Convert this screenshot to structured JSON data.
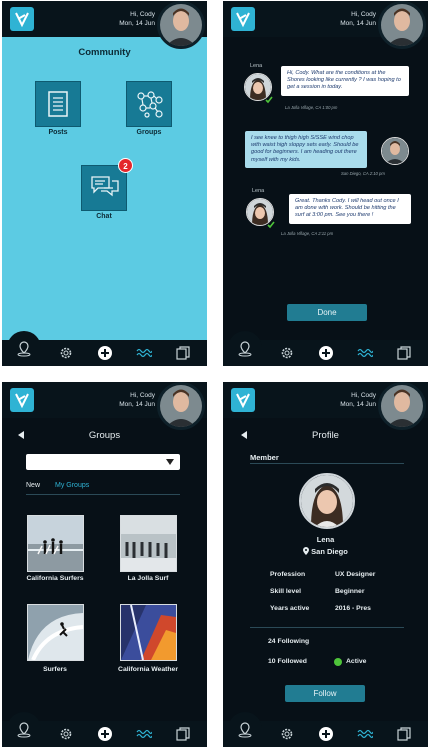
{
  "colors": {
    "accent": "#2fb3d4",
    "primary_button": "#217c92",
    "screen_bg": "#071017",
    "community_bg": "#5ccbe3",
    "badge": "#e4262b",
    "active_dot": "#4ec43a"
  },
  "header": {
    "greeting": "Hi, Cody",
    "date": "Mon, 14 Jun"
  },
  "nav_icons": [
    "map-pin-icon",
    "gear-icon",
    "plus-icon",
    "waves-icon",
    "copy-icon"
  ],
  "community": {
    "title": "Community",
    "tiles": [
      {
        "label": "Posts",
        "icon": "document-icon"
      },
      {
        "label": "Groups",
        "icon": "network-icon"
      },
      {
        "label": "Chat",
        "icon": "chat-icon",
        "badge": "2"
      }
    ]
  },
  "chat": {
    "messages": [
      {
        "sender": "Lena",
        "text": "Hi, Cody. What are the conditions at the Shores looking like currently ? I was hoping to get a session in today.",
        "meta": "La Jolla Village, CA 1:00 pm"
      },
      {
        "sender": "",
        "text": "I see knee to thigh high S/SSE wind chop with waist high sloppy sets early. Should be good for beginners. I am heading out there myself with my kids.",
        "meta": "San Diego, CA 2:10 pm"
      },
      {
        "sender": "Lena",
        "text": "Great. Thanks Cody. I will head out once I am done with work. Should be hitting the surf at 3:00 pm. See you there !",
        "meta": "La Jolla Village, CA 2:11 pm"
      }
    ],
    "done_label": "Done"
  },
  "groups": {
    "title": "Groups",
    "dropdown_value": "",
    "tabs": [
      "New",
      "My Groups"
    ],
    "items": [
      {
        "label": "California Surfers"
      },
      {
        "label": "La Jolla Surf"
      },
      {
        "label": "Surfers"
      },
      {
        "label": "California Weather"
      }
    ]
  },
  "profile": {
    "title": "Profile",
    "section": "Member",
    "name": "Lena",
    "location": "San Diego",
    "fields": [
      {
        "key": "Profession",
        "value": "UX Designer"
      },
      {
        "key": "Skill level",
        "value": "Beginner"
      },
      {
        "key": "Years active",
        "value": "2016 - Pres"
      }
    ],
    "following": "24 Following",
    "followed": "10 Followed",
    "status": "Active",
    "follow_label": "Follow"
  }
}
